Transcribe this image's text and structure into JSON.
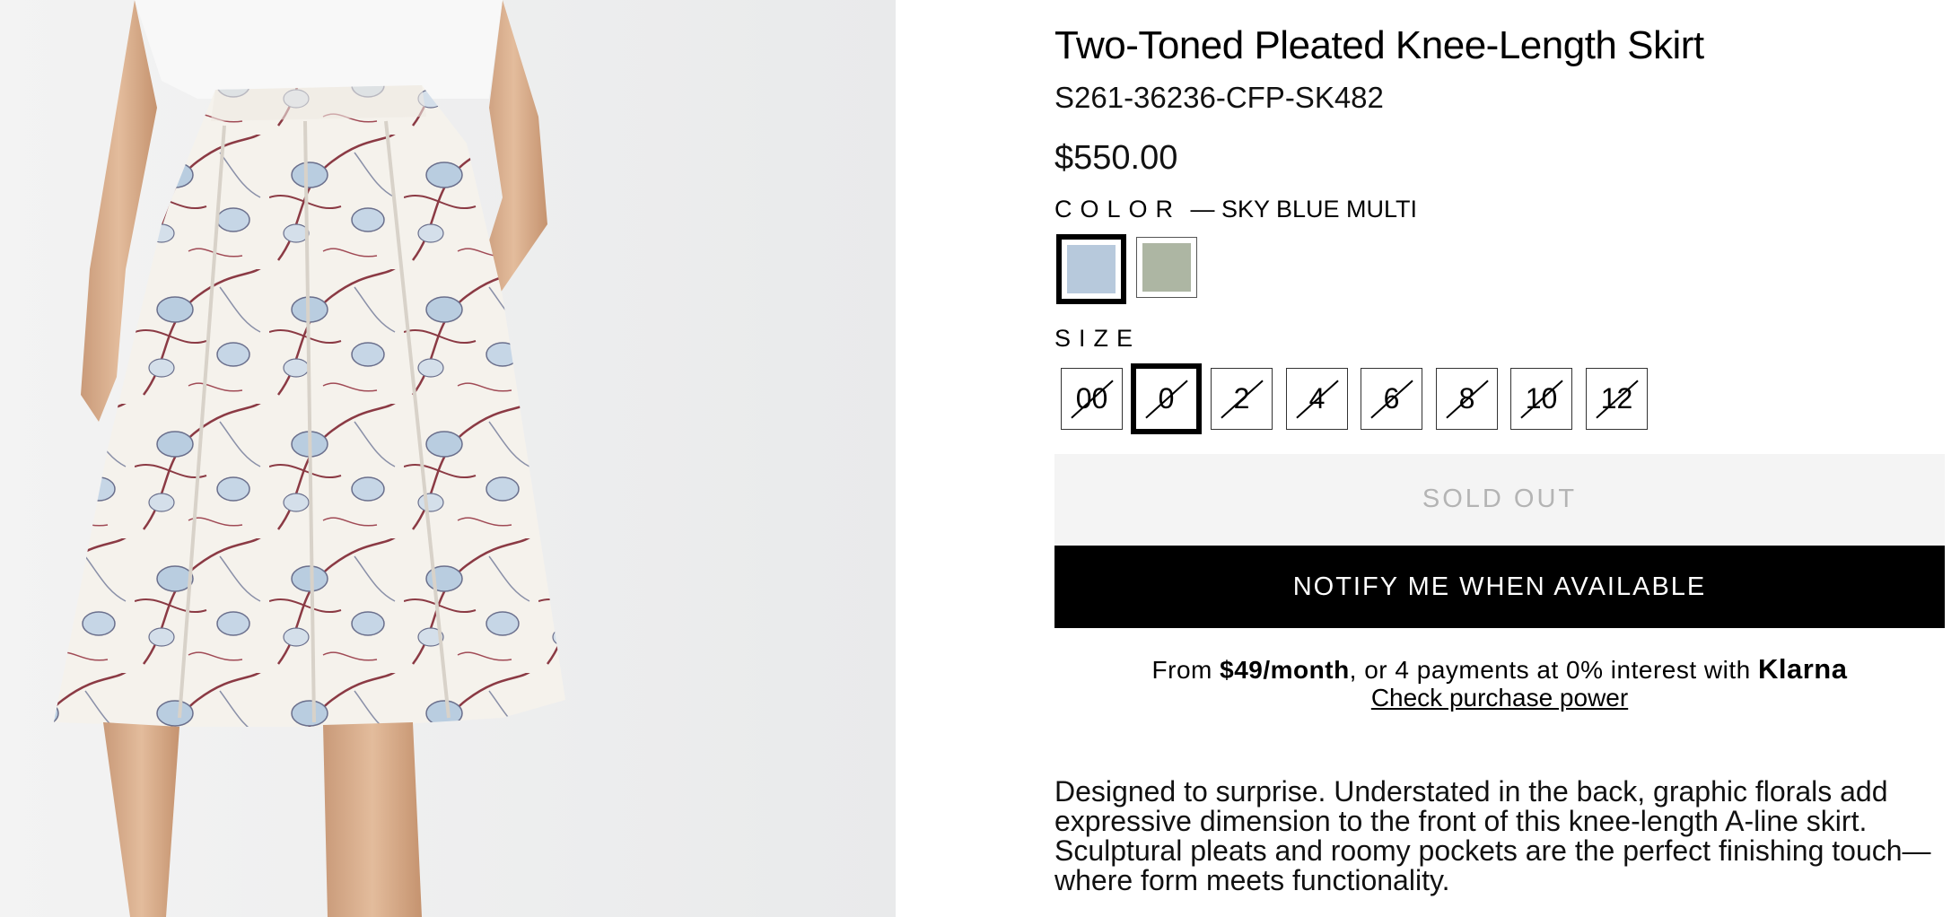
{
  "product": {
    "title": "Two-Toned Pleated Knee-Length Skirt",
    "sku": "S261-36236-CFP-SK482",
    "price": "$550.00",
    "image_alt": "Floral pleated skirt"
  },
  "color": {
    "label": "COLOR",
    "selected_value": "— SKY BLUE MULTI",
    "swatches": [
      {
        "name": "sky blue multi",
        "hex": "#b7c9dc",
        "selected": true
      },
      {
        "name": "sage",
        "hex": "#adb6a3",
        "selected": false
      }
    ]
  },
  "size": {
    "label": "SIZE",
    "options": [
      "00",
      "0",
      "2",
      "4",
      "6",
      "8",
      "10",
      "12"
    ],
    "selected": "0",
    "all_unavailable": true
  },
  "actions": {
    "sold_out_label": "SOLD OUT",
    "notify_label": "NOTIFY ME WHEN AVAILABLE"
  },
  "financing": {
    "prefix": "From ",
    "amount": "$49/month",
    "middle": ", or 4 payments at 0% interest with ",
    "brand": "Klarna",
    "link_label": "Check purchase power"
  },
  "description": "Designed to surprise. Understated in the back, graphic florals add expressive dimension to the front of this knee-length A-line skirt. Sculptural pleats and roomy pockets are the perfect finishing touch—where form meets functionality.",
  "colors": {
    "accent": "#000000",
    "sold_out_bg": "#f4f4f4",
    "sold_out_text": "#b4b4b4"
  }
}
